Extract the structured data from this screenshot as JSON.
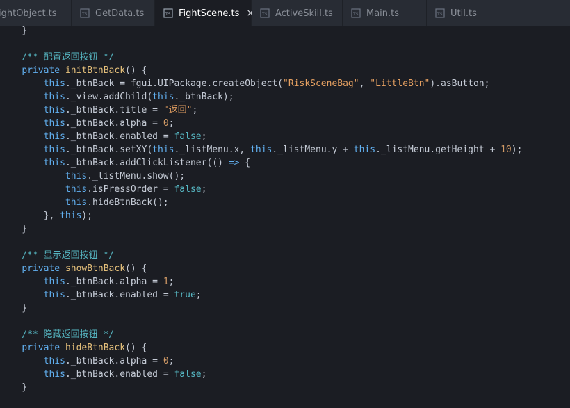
{
  "tabs": [
    {
      "label": "ightObject.ts",
      "active": false,
      "icon": "typescript-file-icon"
    },
    {
      "label": "GetData.ts",
      "active": false,
      "icon": "typescript-file-icon"
    },
    {
      "label": "FightScene.ts",
      "active": true,
      "icon": "typescript-file-icon",
      "close": "×"
    },
    {
      "label": "ActiveSkill.ts",
      "active": false,
      "icon": "typescript-file-icon"
    },
    {
      "label": "Main.ts",
      "active": false,
      "icon": "typescript-file-icon"
    },
    {
      "label": "Util.ts",
      "active": false,
      "icon": "typescript-file-icon"
    }
  ],
  "code": {
    "l1": "    }",
    "l3": "    /** 配置返回按钮 */",
    "l4": [
      "    ",
      "private",
      " ",
      "initBtnBack",
      "() {"
    ],
    "l5": [
      "        ",
      "this",
      "._btnBack = fgui.UIPackage.createObject(",
      "\"RiskSceneBag\"",
      ", ",
      "\"LittleBtn\"",
      ").asButton;"
    ],
    "l6": [
      "        ",
      "this",
      "._view.addChild(",
      "this",
      "._btnBack);"
    ],
    "l7": [
      "        ",
      "this",
      "._btnBack.title = ",
      "\"返回\"",
      ";"
    ],
    "l8": [
      "        ",
      "this",
      "._btnBack.alpha = ",
      "0",
      ";"
    ],
    "l9": [
      "        ",
      "this",
      "._btnBack.enabled = ",
      "false",
      ";"
    ],
    "l10": [
      "        ",
      "this",
      "._btnBack.setXY(",
      "this",
      "._listMenu.x, ",
      "this",
      "._listMenu.y + ",
      "this",
      "._listMenu.getHeight + ",
      "10",
      ");"
    ],
    "l11": [
      "        ",
      "this",
      "._btnBack.addClickListener(() ",
      "=>",
      " {"
    ],
    "l12": [
      "            ",
      "this",
      "._listMenu.show();"
    ],
    "l13": [
      "            ",
      "this",
      ".isPressOrder = ",
      "false",
      ";"
    ],
    "l14": [
      "            ",
      "this",
      ".hideBtnBack();"
    ],
    "l15": [
      "        }, ",
      "this",
      ");"
    ],
    "l16": "    }",
    "l18": "    /** 显示返回按钮 */",
    "l19": [
      "    ",
      "private",
      " ",
      "showBtnBack",
      "() {"
    ],
    "l20": [
      "        ",
      "this",
      "._btnBack.alpha = ",
      "1",
      ";"
    ],
    "l21": [
      "        ",
      "this",
      "._btnBack.enabled = ",
      "true",
      ";"
    ],
    "l22": "    }",
    "l24": "    /** 隐藏返回按钮 */",
    "l25": [
      "    ",
      "private",
      " ",
      "hideBtnBack",
      "() {"
    ],
    "l26": [
      "        ",
      "this",
      "._btnBack.alpha = ",
      "0",
      ";"
    ],
    "l27": [
      "        ",
      "this",
      "._btnBack.enabled = ",
      "false",
      ";"
    ],
    "l28": "    }"
  },
  "colors": {
    "background": "#1b1d23",
    "tabbar": "#282c34",
    "keyword": "#61afef",
    "function": "#e5c07b",
    "string": "#e5a061",
    "number": "#d19a66",
    "boolean": "#56b6c2",
    "comment": "#56b6c2"
  }
}
